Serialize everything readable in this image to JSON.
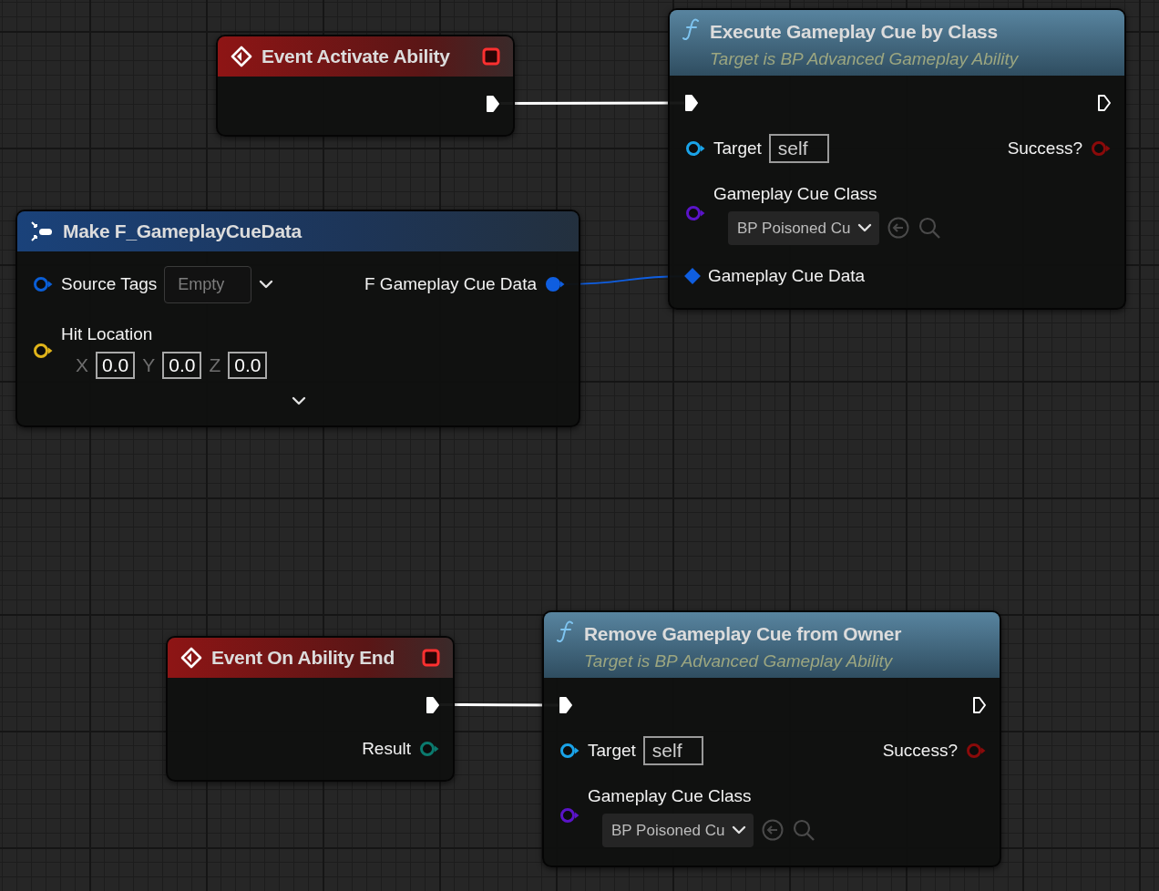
{
  "nodes": [
    {
      "kind": "event",
      "title": "Event Activate Ability",
      "rows": [
        {
          "kind": "pins",
          "right": {
            "kind": "exec",
            "connected": true
          }
        }
      ]
    },
    {
      "kind": "function",
      "title": "Execute Gameplay Cue by Class",
      "subtitle": "Target is BP Advanced Gameplay Ability",
      "rows": [
        {
          "kind": "pins",
          "left": {
            "kind": "exec",
            "connected": true
          },
          "right": {
            "kind": "exec",
            "connected": false
          }
        },
        {
          "kind": "pins",
          "left": {
            "kind": "object",
            "color": "#1aa3e8",
            "label": "Target",
            "value": "self"
          },
          "right": {
            "kind": "bool",
            "color": "#8a0a0a",
            "label": "Success?"
          }
        },
        {
          "kind": "pins",
          "left": {
            "kind": "class",
            "color": "#5a14c8",
            "label": "Gameplay Cue Class",
            "value": "BP Poisoned Cu"
          }
        },
        {
          "kind": "pins",
          "left": {
            "kind": "ref",
            "color": "#0f5ee0",
            "label": "Gameplay Cue Data",
            "connected": true
          }
        }
      ]
    },
    {
      "kind": "make",
      "title": "Make F_GameplayCueData",
      "rows": [
        {
          "kind": "pins",
          "left": {
            "kind": "tags",
            "color": "#0a5ed6",
            "label": "Source Tags",
            "placeholder": "Empty"
          },
          "right": {
            "kind": "struct",
            "color": "#0f5ee0",
            "label": "F Gameplay Cue Data",
            "connected": true
          }
        },
        {
          "kind": "pins",
          "left": {
            "kind": "vector",
            "color": "#e0b41a",
            "label": "Hit Location",
            "axes": [
              {
                "axis": "X",
                "value": "0.0"
              },
              {
                "axis": "Y",
                "value": "0.0"
              },
              {
                "axis": "Z",
                "value": "0.0"
              }
            ]
          }
        },
        {
          "kind": "expand"
        }
      ]
    },
    {
      "kind": "event",
      "title": "Event On Ability End",
      "rows": [
        {
          "kind": "pins",
          "right": {
            "kind": "exec",
            "connected": true
          }
        },
        {
          "kind": "pins",
          "right": {
            "kind": "struct",
            "color": "#0b7a6e",
            "label": "Result",
            "connected": false
          }
        }
      ]
    },
    {
      "kind": "function",
      "title": "Remove Gameplay Cue from Owner",
      "subtitle": "Target is BP Advanced Gameplay Ability",
      "rows": [
        {
          "kind": "pins",
          "left": {
            "kind": "exec",
            "connected": true
          },
          "right": {
            "kind": "exec",
            "connected": false
          }
        },
        {
          "kind": "pins",
          "left": {
            "kind": "object",
            "color": "#1aa3e8",
            "label": "Target",
            "value": "self"
          },
          "right": {
            "kind": "bool",
            "color": "#8a0a0a",
            "label": "Success?"
          }
        },
        {
          "kind": "pins",
          "left": {
            "kind": "class",
            "color": "#5a14c8",
            "label": "Gameplay Cue Class",
            "value": "BP Poisoned Cu"
          }
        }
      ]
    }
  ]
}
